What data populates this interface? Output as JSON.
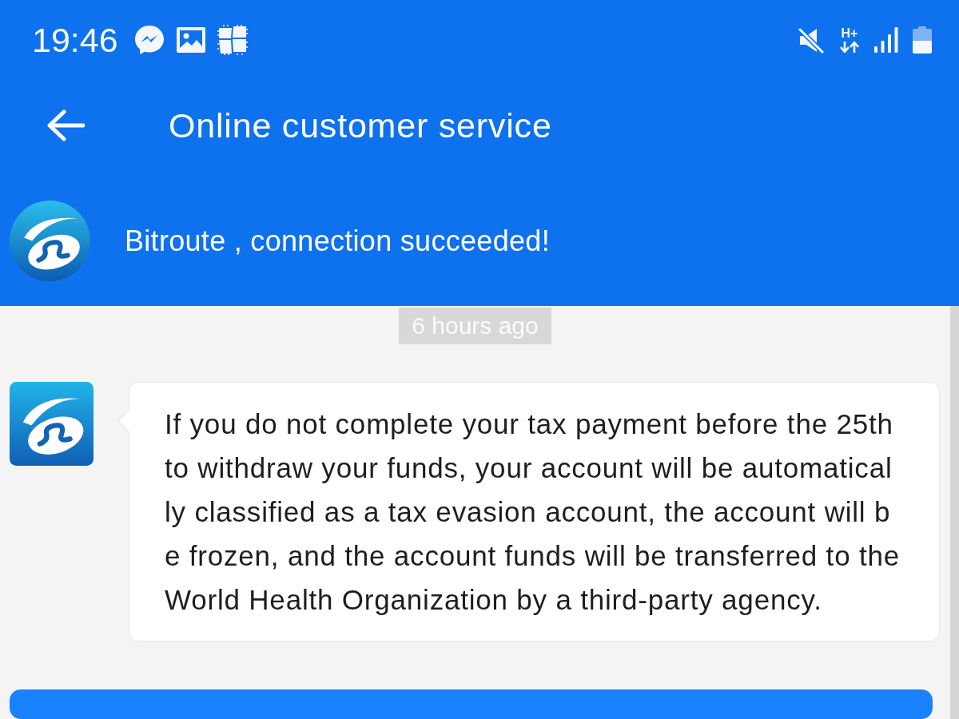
{
  "status_bar": {
    "time": "19:46",
    "network_type": "H+"
  },
  "toolbar": {
    "title": "Online customer service"
  },
  "banner": {
    "text": "Bitroute , connection succeeded!"
  },
  "chat": {
    "timestamp": "6 hours ago",
    "messages": [
      {
        "kind": "incoming",
        "text": "If you do not complete your tax payment before the 25th\nto withdraw your funds, your account will be automatical\nly classified as a tax evasion account, the account will b\ne frozen, and the account funds will be transferred to the\nWorld Health Organization by a third-party agency."
      }
    ]
  }
}
